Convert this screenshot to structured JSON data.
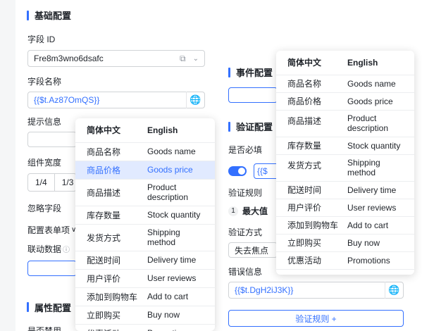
{
  "basic": {
    "section_title": "基础配置",
    "field_id_label": "字段 ID",
    "field_id_value": "Fre8m3wno6dsafc",
    "field_name_label": "字段名称",
    "field_name_value": "{{$t.Az87OmQS}}",
    "hint_label": "提示信息",
    "width_label": "组件宽度",
    "width_options": [
      "1/4",
      "1/3"
    ],
    "ignore_label": "忽略字段",
    "config_single_label": "配置表单项",
    "linked_data_label": "联动数据"
  },
  "attr": {
    "section_title": "属性配置",
    "disabled_label": "是否禁用"
  },
  "event": {
    "section_title": "事件配置"
  },
  "validation": {
    "section_title": "验证配置",
    "required_label": "是否必填",
    "required_value_prefix": "{{$",
    "rules_label": "验证规则",
    "rule_index": "1",
    "rule_name": "最大值",
    "method_label": "验证方式",
    "method_value": "失去焦点",
    "error_label": "错误信息",
    "error_value": "{{$t.DgH2iJ3K}}",
    "add_rule_button": "验证规则 +"
  },
  "popup_left": {
    "headers": [
      "简体中文",
      "English"
    ],
    "rows": [
      [
        "商品名称",
        "Goods name"
      ],
      [
        "商品价格",
        "Goods price"
      ],
      [
        "商品描述",
        "Product description"
      ],
      [
        "库存数量",
        "Stock quantity"
      ],
      [
        "发货方式",
        "Shipping method"
      ],
      [
        "配送时间",
        "Delivery time"
      ],
      [
        "用户评价",
        "User reviews"
      ],
      [
        "添加到购物车",
        "Add to cart"
      ],
      [
        "立即购买",
        "Buy now"
      ],
      [
        "优惠活动",
        "Promotions"
      ]
    ],
    "selected_index": 1
  },
  "popup_right": {
    "headers": [
      "简体中文",
      "English"
    ],
    "rows": [
      [
        "商品名称",
        "Goods name"
      ],
      [
        "商品价格",
        "Goods price"
      ],
      [
        "商品描述",
        "Product description"
      ],
      [
        "库存数量",
        "Stock quantity"
      ],
      [
        "发货方式",
        "Shipping method"
      ],
      [
        "配送时间",
        "Delivery time"
      ],
      [
        "用户评价",
        "User reviews"
      ],
      [
        "添加到购物车",
        "Add to cart"
      ],
      [
        "立即购买",
        "Buy now"
      ],
      [
        "优惠活动",
        "Promotions"
      ]
    ]
  }
}
